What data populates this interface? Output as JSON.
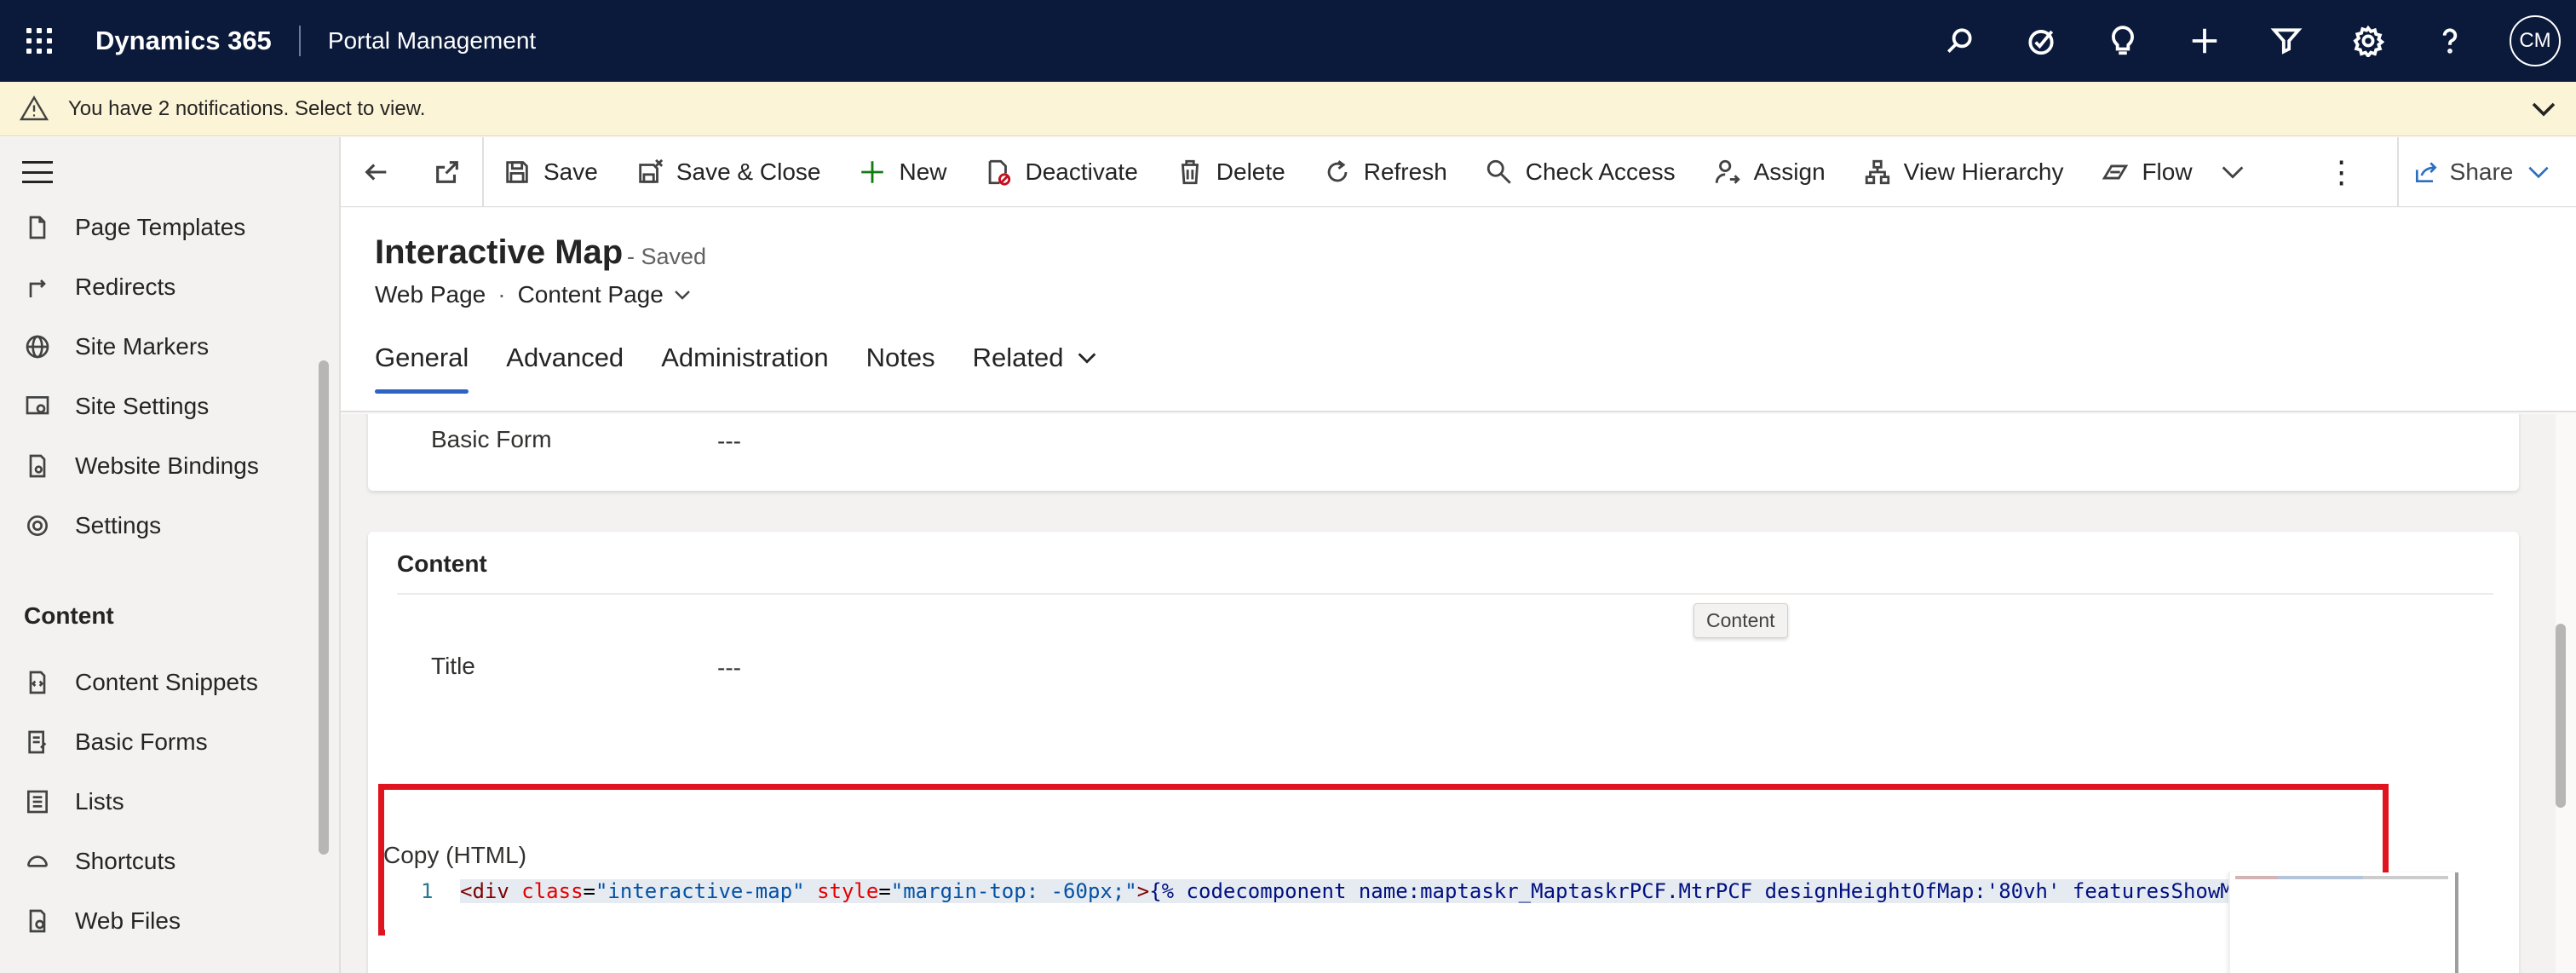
{
  "topbar": {
    "app_name": "Dynamics 365",
    "area_name": "Portal Management",
    "icons": [
      "search-icon",
      "task-check-icon",
      "lightbulb-icon",
      "plus-icon",
      "filter-icon",
      "gear-icon",
      "help-icon"
    ],
    "avatar_initials": "CM",
    "bg_color": "#0b1a3a"
  },
  "notification": {
    "text": "You have 2 notifications. Select to view.",
    "bg_color": "#fcf4d6"
  },
  "sidebar": {
    "items_top": [
      {
        "label": "Page Templates",
        "icon": "page-template-icon"
      },
      {
        "label": "Redirects",
        "icon": "redirect-icon"
      },
      {
        "label": "Site Markers",
        "icon": "globe-icon"
      },
      {
        "label": "Site Settings",
        "icon": "site-settings-icon"
      },
      {
        "label": "Website Bindings",
        "icon": "binding-icon"
      },
      {
        "label": "Settings",
        "icon": "gear-icon"
      }
    ],
    "group_label": "Content",
    "items_content": [
      {
        "label": "Content Snippets",
        "icon": "snippet-icon"
      },
      {
        "label": "Basic Forms",
        "icon": "form-icon"
      },
      {
        "label": "Lists",
        "icon": "list-icon"
      },
      {
        "label": "Shortcuts",
        "icon": "shortcut-icon"
      },
      {
        "label": "Web Files",
        "icon": "web-file-icon"
      }
    ]
  },
  "commandbar": {
    "save": "Save",
    "save_close": "Save & Close",
    "new": "New",
    "deactivate": "Deactivate",
    "delete": "Delete",
    "refresh": "Refresh",
    "check_access": "Check Access",
    "assign": "Assign",
    "view_hierarchy": "View Hierarchy",
    "flow": "Flow",
    "more": "⋮",
    "share": "Share"
  },
  "record": {
    "title": "Interactive Map",
    "status": "- Saved",
    "entity": "Web Page",
    "separator": "·",
    "form_selector": "Content Page",
    "tabs": [
      "General",
      "Advanced",
      "Administration",
      "Notes",
      "Related"
    ],
    "active_tab": "General"
  },
  "form": {
    "basic_form_label": "Basic Form",
    "basic_form_value": "---",
    "content_section_title": "Content",
    "tooltip": "Content",
    "title_label": "Title",
    "title_value": "---",
    "copy_label": "Copy (HTML)",
    "code_line_number": "1",
    "code": {
      "lt": "<",
      "tag": "div",
      "sp1": " ",
      "attr1": "class",
      "eq1": "=",
      "val1": "\"interactive-map\"",
      "sp2": " ",
      "attr2": "style",
      "eq2": "=",
      "val2": "\"margin-top: -60px;\"",
      "gt": ">",
      "liquid": "{% codecomponent name:maptaskr_MaptaskrPCF.MtrPCF designHeightOfMap:'80vh' featuresShowMa"
    },
    "highlight_color": "#e0141e"
  }
}
